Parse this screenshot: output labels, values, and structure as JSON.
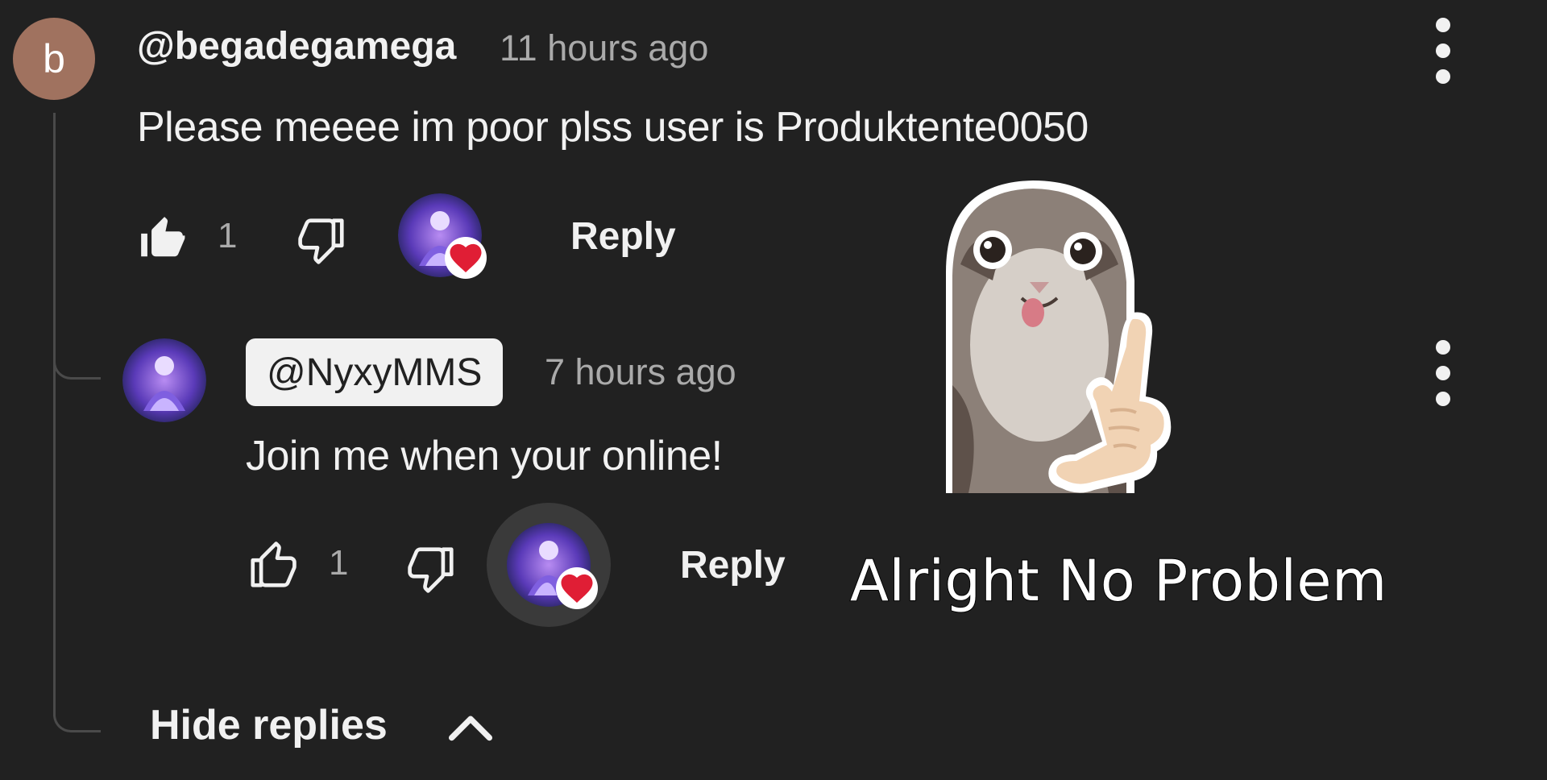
{
  "comment": {
    "avatar_letter": "b",
    "handle": "@begadegamega",
    "time": "11 hours ago",
    "text": "Please meeee im poor plss user is Produktente0050",
    "like_count": "1",
    "reply_label": "Reply",
    "liked": true,
    "creator_heart": true
  },
  "reply": {
    "handle": "@NyxyMMS",
    "time": "7 hours ago",
    "text": "Join me when your online!",
    "like_count": "1",
    "reply_label": "Reply",
    "liked": false,
    "creator_heart": true
  },
  "hide_replies_label": "Hide replies",
  "overlay": {
    "caption": "Alright No Problem",
    "sticker": "cat-thumbs-up-sticker"
  },
  "colors": {
    "background": "#212121",
    "text": "#f1f1f1",
    "secondary_text": "#aaaaaa",
    "avatar_letter_bg": "#a0725f",
    "heart": "#e01e35"
  }
}
